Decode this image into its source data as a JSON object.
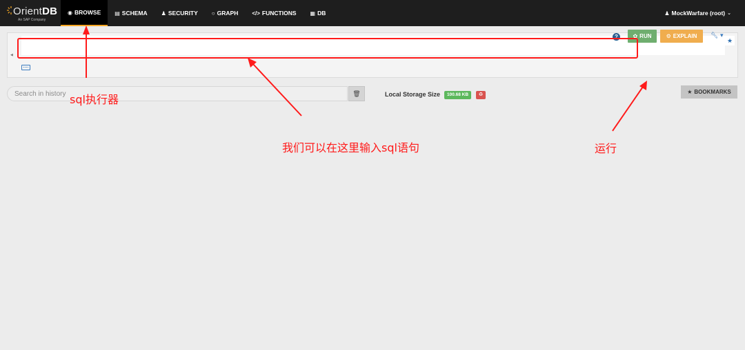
{
  "navbar": {
    "logo": {
      "text_main": "Orient",
      "text_bold": "DB",
      "subtitle": "An SAP Company"
    },
    "items": [
      {
        "label": "BROWSE",
        "icon": "eye-icon",
        "glyph": "◉",
        "active": true
      },
      {
        "label": "SCHEMA",
        "icon": "table-icon",
        "glyph": "▤",
        "active": false
      },
      {
        "label": "SECURITY",
        "icon": "user-icon",
        "glyph": "♟",
        "active": false
      },
      {
        "label": "GRAPH",
        "icon": "circle-icon",
        "glyph": "○",
        "active": false
      },
      {
        "label": "FUNCTIONS",
        "icon": "code-icon",
        "glyph": "</>",
        "active": false
      },
      {
        "label": "DB",
        "icon": "database-icon",
        "glyph": "▦",
        "active": false
      }
    ],
    "user": {
      "label": "MockWarfare (root)",
      "icon": "user-icon"
    }
  },
  "editor": {
    "value": ""
  },
  "toolbar": {
    "run_label": "RUN",
    "explain_label": "EXPLAIN"
  },
  "history": {
    "search_placeholder": "Search in history",
    "storage_label": "Local Storage Size",
    "storage_size": "100.68 KB"
  },
  "bookmarks_label": "BOOKMARKS",
  "annotations": {
    "executor": "sql执行器",
    "input_hint": "我们可以在这里输入sql语句",
    "run_hint": "运行"
  },
  "colors": {
    "navbar_bg": "#1e1e1e",
    "active_underline": "#f5a623",
    "run_green": "#6fae6f",
    "explain_orange": "#f0ad4e",
    "storage_green": "#5cb85c",
    "reset_red": "#d9534f",
    "annotation_red": "#ff1a1a"
  }
}
